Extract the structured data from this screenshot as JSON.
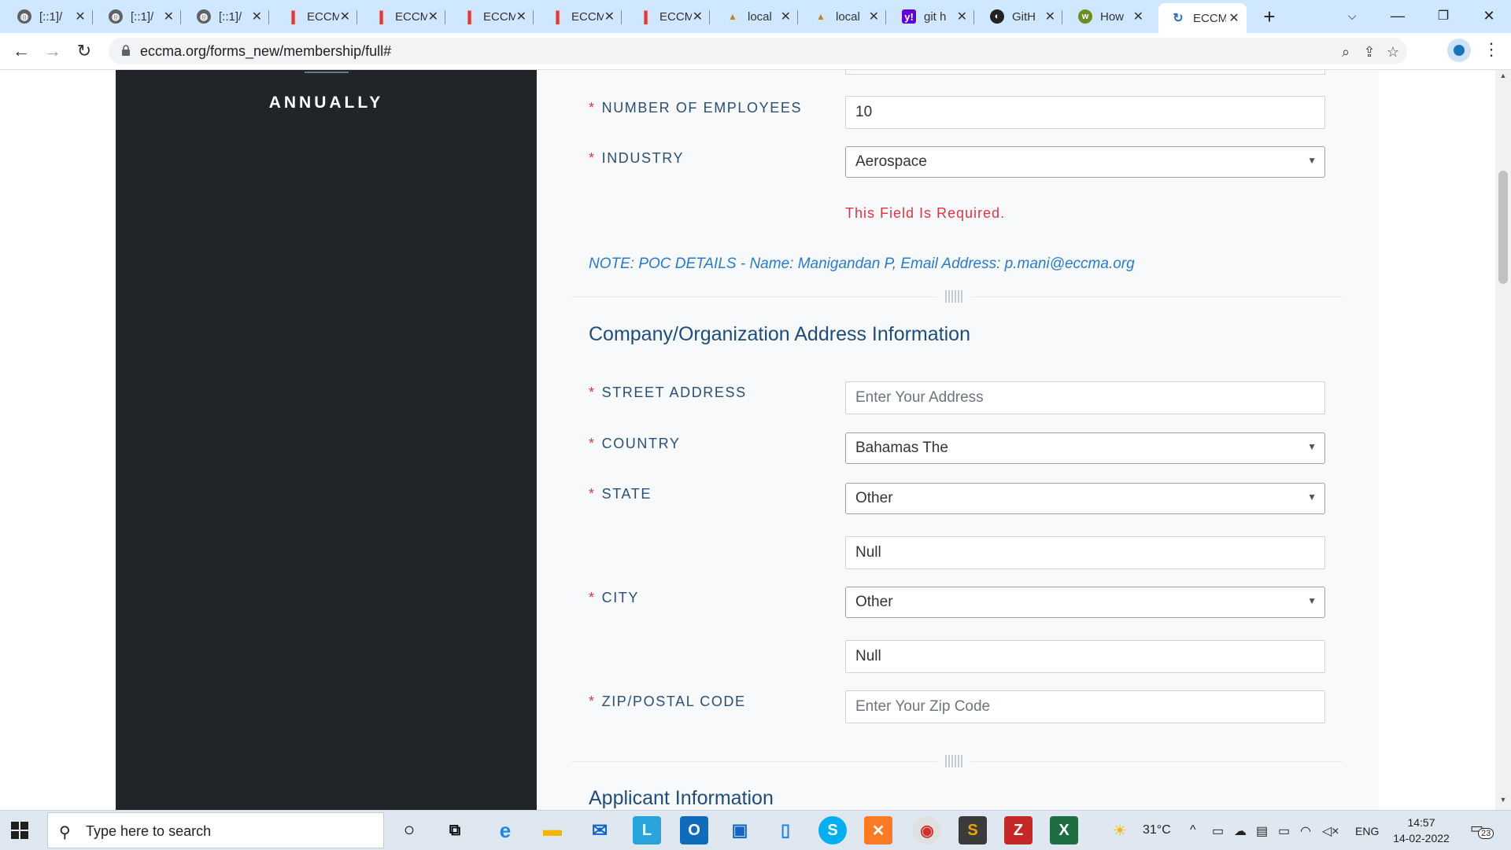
{
  "browser": {
    "tabs": [
      {
        "title": "[::1]/",
        "favicon": "globe-icon"
      },
      {
        "title": "[::1]/",
        "favicon": "globe-icon"
      },
      {
        "title": "[::1]/",
        "favicon": "globe-icon"
      },
      {
        "title": "ECCM",
        "favicon": "eccma-icon"
      },
      {
        "title": "ECCM",
        "favicon": "eccma-icon"
      },
      {
        "title": "ECCM",
        "favicon": "eccma-icon"
      },
      {
        "title": "ECCM",
        "favicon": "eccma-icon"
      },
      {
        "title": "ECCM",
        "favicon": "eccma-icon"
      },
      {
        "title": "local",
        "favicon": "pma-icon"
      },
      {
        "title": "local",
        "favicon": "pma-icon"
      },
      {
        "title": "git h",
        "favicon": "yahoo-icon"
      },
      {
        "title": "GitH",
        "favicon": "github-icon"
      },
      {
        "title": "How",
        "favicon": "how-icon"
      },
      {
        "title": "ECCM",
        "favicon": "eccma-active-icon",
        "active": true
      }
    ],
    "url": "eccma.org/forms_new/membership/full#"
  },
  "sidebar": {
    "plan_period": "ANNUALLY"
  },
  "form": {
    "employees": {
      "label": "NUMBER OF EMPLOYEES",
      "value": "10"
    },
    "industry": {
      "label": "INDUSTRY",
      "value": "Aerospace",
      "error": "This Field Is Required."
    },
    "note": "NOTE: POC DETAILS - Name: Manigandan P, Email Address: p.mani@eccma.org",
    "address_section": {
      "title": "Company/Organization Address Information",
      "street": {
        "label": "STREET ADDRESS",
        "placeholder": "Enter Your Address"
      },
      "country": {
        "label": "COUNTRY",
        "value": "Bahamas The"
      },
      "state": {
        "label": "STATE",
        "value": "Other",
        "other_value": "Null"
      },
      "city": {
        "label": "CITY",
        "value": "Other",
        "other_value": "Null"
      },
      "zip": {
        "label": "ZIP/POSTAL CODE",
        "placeholder": "Enter Your Zip Code"
      }
    },
    "applicant_section": {
      "title": "Applicant Information"
    },
    "required_marker": "*"
  },
  "taskbar": {
    "search_placeholder": "Type here to search",
    "weather": "31°C",
    "language": "ENG",
    "time": "14:57",
    "date": "14-02-2022",
    "notifications": "23"
  }
}
